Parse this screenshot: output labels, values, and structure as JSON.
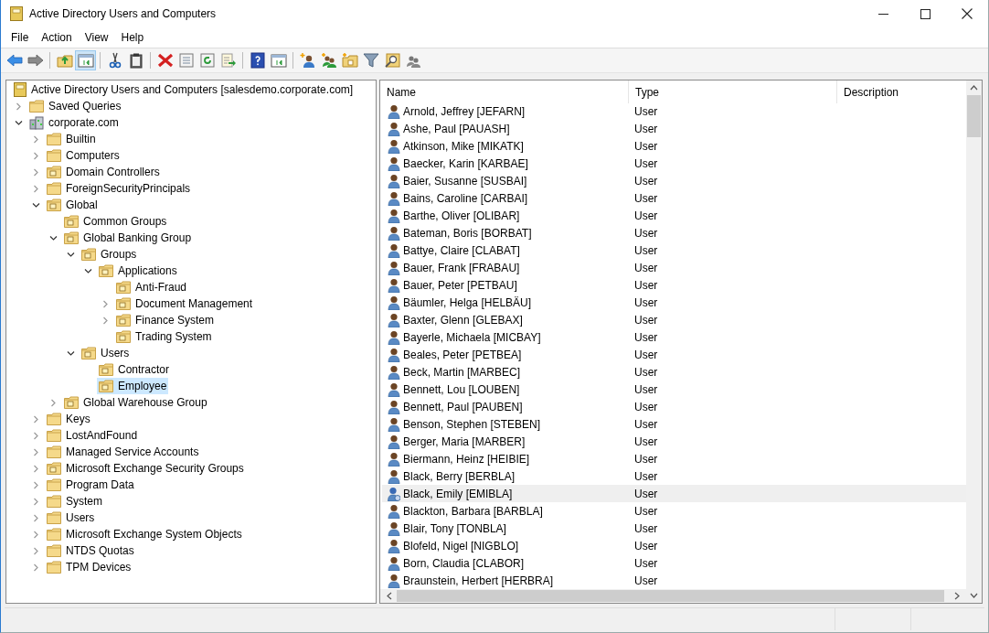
{
  "window": {
    "title": "Active Directory Users and Computers"
  },
  "menu": [
    "File",
    "Action",
    "View",
    "Help"
  ],
  "toolbar": [
    {
      "kind": "back",
      "pressed": false
    },
    {
      "kind": "forward",
      "pressed": false
    },
    {
      "kind": "sep"
    },
    {
      "kind": "up",
      "pressed": false
    },
    {
      "kind": "tree-pane",
      "pressed": true
    },
    {
      "kind": "sep"
    },
    {
      "kind": "cut",
      "pressed": false
    },
    {
      "kind": "paste",
      "pressed": false
    },
    {
      "kind": "sep"
    },
    {
      "kind": "delete",
      "pressed": false
    },
    {
      "kind": "properties",
      "pressed": false
    },
    {
      "kind": "refresh",
      "pressed": false
    },
    {
      "kind": "export",
      "pressed": false
    },
    {
      "kind": "sep"
    },
    {
      "kind": "help",
      "pressed": false
    },
    {
      "kind": "action-pane",
      "pressed": false
    },
    {
      "kind": "sep"
    },
    {
      "kind": "new-user",
      "pressed": false
    },
    {
      "kind": "new-group",
      "pressed": false
    },
    {
      "kind": "new-ou",
      "pressed": false
    },
    {
      "kind": "filter",
      "pressed": false
    },
    {
      "kind": "find",
      "pressed": false
    },
    {
      "kind": "add-to-group",
      "pressed": false
    }
  ],
  "tree": [
    {
      "label": "Active Directory Users and Computers [salesdemo.corporate.com]",
      "kind": "root",
      "selected": false,
      "children": [
        {
          "label": "Saved Queries",
          "kind": "folder",
          "expanded": false,
          "selected": false
        },
        {
          "label": "corporate.com",
          "kind": "domain",
          "expanded": true,
          "selected": false,
          "children": [
            {
              "label": "Builtin",
              "kind": "folder",
              "expanded": false,
              "selected": false
            },
            {
              "label": "Computers",
              "kind": "folder",
              "expanded": false,
              "selected": false
            },
            {
              "label": "Domain Controllers",
              "kind": "ou",
              "expanded": false,
              "selected": false
            },
            {
              "label": "ForeignSecurityPrincipals",
              "kind": "folder",
              "expanded": false,
              "selected": false
            },
            {
              "label": "Global",
              "kind": "ou",
              "expanded": true,
              "selected": false,
              "children": [
                {
                  "label": "Common Groups",
                  "kind": "ou",
                  "selected": false
                },
                {
                  "label": "Global Banking Group",
                  "kind": "ou",
                  "expanded": true,
                  "selected": false,
                  "children": [
                    {
                      "label": "Groups",
                      "kind": "ou",
                      "expanded": true,
                      "selected": false,
                      "children": [
                        {
                          "label": "Applications",
                          "kind": "ou",
                          "expanded": true,
                          "selected": false,
                          "children": [
                            {
                              "label": "Anti-Fraud",
                              "kind": "ou",
                              "selected": false
                            },
                            {
                              "label": "Document Management",
                              "kind": "ou",
                              "expanded": false,
                              "selected": false
                            },
                            {
                              "label": "Finance System",
                              "kind": "ou",
                              "expanded": false,
                              "selected": false
                            },
                            {
                              "label": "Trading System",
                              "kind": "ou",
                              "selected": false
                            }
                          ]
                        }
                      ]
                    },
                    {
                      "label": "Users",
                      "kind": "ou",
                      "expanded": true,
                      "selected": false,
                      "children": [
                        {
                          "label": "Contractor",
                          "kind": "ou",
                          "selected": false
                        },
                        {
                          "label": "Employee",
                          "kind": "ou",
                          "selected": true
                        }
                      ]
                    }
                  ]
                },
                {
                  "label": "Global Warehouse Group",
                  "kind": "ou",
                  "expanded": false,
                  "selected": false
                }
              ]
            },
            {
              "label": "Keys",
              "kind": "folder",
              "expanded": false,
              "selected": false
            },
            {
              "label": "LostAndFound",
              "kind": "folder",
              "expanded": false,
              "selected": false
            },
            {
              "label": "Managed Service Accounts",
              "kind": "folder",
              "expanded": false,
              "selected": false
            },
            {
              "label": "Microsoft Exchange Security Groups",
              "kind": "ou",
              "expanded": false,
              "selected": false
            },
            {
              "label": "Program Data",
              "kind": "folder",
              "expanded": false,
              "selected": false
            },
            {
              "label": "System",
              "kind": "folder",
              "expanded": false,
              "selected": false
            },
            {
              "label": "Users",
              "kind": "folder",
              "expanded": false,
              "selected": false
            },
            {
              "label": "Microsoft Exchange System Objects",
              "kind": "folder",
              "expanded": false,
              "selected": false
            },
            {
              "label": "NTDS Quotas",
              "kind": "folder",
              "expanded": false,
              "selected": false
            },
            {
              "label": "TPM Devices",
              "kind": "folder",
              "expanded": false,
              "selected": false
            }
          ]
        }
      ]
    }
  ],
  "list": {
    "columns": [
      "Name",
      "Type",
      "Description"
    ],
    "rows": [
      {
        "name": "Arnold, Jeffrey [JEFARN]",
        "type": "User",
        "kind": "user",
        "highlighted": false
      },
      {
        "name": "Ashe, Paul [PAUASH]",
        "type": "User",
        "kind": "user",
        "highlighted": false
      },
      {
        "name": "Atkinson, Mike [MIKATK]",
        "type": "User",
        "kind": "user",
        "highlighted": false
      },
      {
        "name": "Baecker, Karin [KARBAE]",
        "type": "User",
        "kind": "user",
        "highlighted": false
      },
      {
        "name": "Baier, Susanne [SUSBAI]",
        "type": "User",
        "kind": "user",
        "highlighted": false
      },
      {
        "name": "Bains, Caroline [CARBAI]",
        "type": "User",
        "kind": "user",
        "highlighted": false
      },
      {
        "name": "Barthe, Oliver [OLIBAR]",
        "type": "User",
        "kind": "user",
        "highlighted": false
      },
      {
        "name": "Bateman, Boris [BORBAT]",
        "type": "User",
        "kind": "user",
        "highlighted": false
      },
      {
        "name": "Battye, Claire [CLABAT]",
        "type": "User",
        "kind": "user",
        "highlighted": false
      },
      {
        "name": "Bauer, Frank [FRABAU]",
        "type": "User",
        "kind": "user",
        "highlighted": false
      },
      {
        "name": "Bauer, Peter [PETBAU]",
        "type": "User",
        "kind": "user",
        "highlighted": false
      },
      {
        "name": "Bäumler, Helga [HELBÄU]",
        "type": "User",
        "kind": "user",
        "highlighted": false
      },
      {
        "name": "Baxter, Glenn [GLEBAX]",
        "type": "User",
        "kind": "user",
        "highlighted": false
      },
      {
        "name": "Bayerle, Michaela [MICBAY]",
        "type": "User",
        "kind": "user",
        "highlighted": false
      },
      {
        "name": "Beales, Peter [PETBEA]",
        "type": "User",
        "kind": "user",
        "highlighted": false
      },
      {
        "name": "Beck, Martin [MARBEC]",
        "type": "User",
        "kind": "user",
        "highlighted": false
      },
      {
        "name": "Bennett, Lou [LOUBEN]",
        "type": "User",
        "kind": "user",
        "highlighted": false
      },
      {
        "name": "Bennett, Paul [PAUBEN]",
        "type": "User",
        "kind": "user",
        "highlighted": false
      },
      {
        "name": "Benson, Stephen [STEBEN]",
        "type": "User",
        "kind": "user",
        "highlighted": false
      },
      {
        "name": "Berger, Maria [MARBER]",
        "type": "User",
        "kind": "user",
        "highlighted": false
      },
      {
        "name": "Biermann, Heinz [HEIBIE]",
        "type": "User",
        "kind": "user",
        "highlighted": false
      },
      {
        "name": "Black, Berry [BERBLA]",
        "type": "User",
        "kind": "user",
        "highlighted": false
      },
      {
        "name": "Black, Emily [EMIBLA]",
        "type": "User",
        "kind": "user-alt",
        "highlighted": true
      },
      {
        "name": "Blackton, Barbara [BARBLA]",
        "type": "User",
        "kind": "user",
        "highlighted": false
      },
      {
        "name": "Blair, Tony [TONBLA]",
        "type": "User",
        "kind": "user",
        "highlighted": false
      },
      {
        "name": "Blofeld, Nigel [NIGBLO]",
        "type": "User",
        "kind": "user",
        "highlighted": false
      },
      {
        "name": "Born, Claudia [CLABOR]",
        "type": "User",
        "kind": "user",
        "highlighted": false
      },
      {
        "name": "Braunstein, Herbert [HERBRA]",
        "type": "User",
        "kind": "user",
        "highlighted": false
      }
    ]
  }
}
